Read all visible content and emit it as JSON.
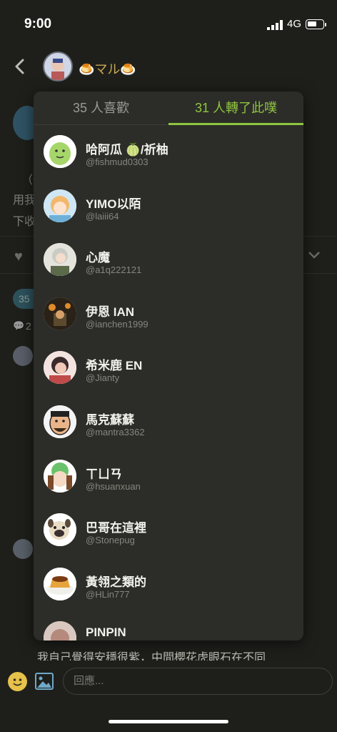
{
  "status_bar": {
    "time": "9:00",
    "network": "4G"
  },
  "header": {
    "name": "🍮マル🍮"
  },
  "background": {
    "line1": "（僞",
    "line2": "用我",
    "line3": "下收",
    "badge": "35",
    "comment_count": "2",
    "bottom_text": "我自己覺得安穩很紫，中間櫻花虎眼石在不同"
  },
  "modal": {
    "tabs": [
      {
        "label": "35 人喜歡",
        "active": false
      },
      {
        "label": "31 人轉了此噗",
        "active": true
      }
    ],
    "users": [
      {
        "name": "哈阿瓜 🍈/祈柚",
        "handle": "@fishmud0303",
        "avatar_color": "#a6d66a"
      },
      {
        "name": "YIMO以陌",
        "handle": "@laiii64",
        "avatar_color": "#f2b76a"
      },
      {
        "name": "心魔",
        "handle": "@a1q222121",
        "avatar_color": "#c9ccc4"
      },
      {
        "name": "伊恩 IAN",
        "handle": "@ianchen1999",
        "avatar_color": "#5b4a2e"
      },
      {
        "name": "希米鹿 EN",
        "handle": "@Jianty",
        "avatar_color": "#d38e86"
      },
      {
        "name": "馬克蘇蘇",
        "handle": "@mantra3362",
        "avatar_color": "#f4f4f4"
      },
      {
        "name": "ㄒㄩㄢ",
        "handle": "@hsuanxuan",
        "avatar_color": "#f5d9c4"
      },
      {
        "name": "巴哥在這裡",
        "handle": "@Stonepug",
        "avatar_color": "#f4f1ea"
      },
      {
        "name": "黃翎之類的",
        "handle": "@HLin777",
        "avatar_color": "#e6a43c"
      },
      {
        "name": "PINPIN",
        "handle": "",
        "avatar_color": "#b58a7c"
      }
    ]
  },
  "composer": {
    "placeholder": "回應..."
  }
}
